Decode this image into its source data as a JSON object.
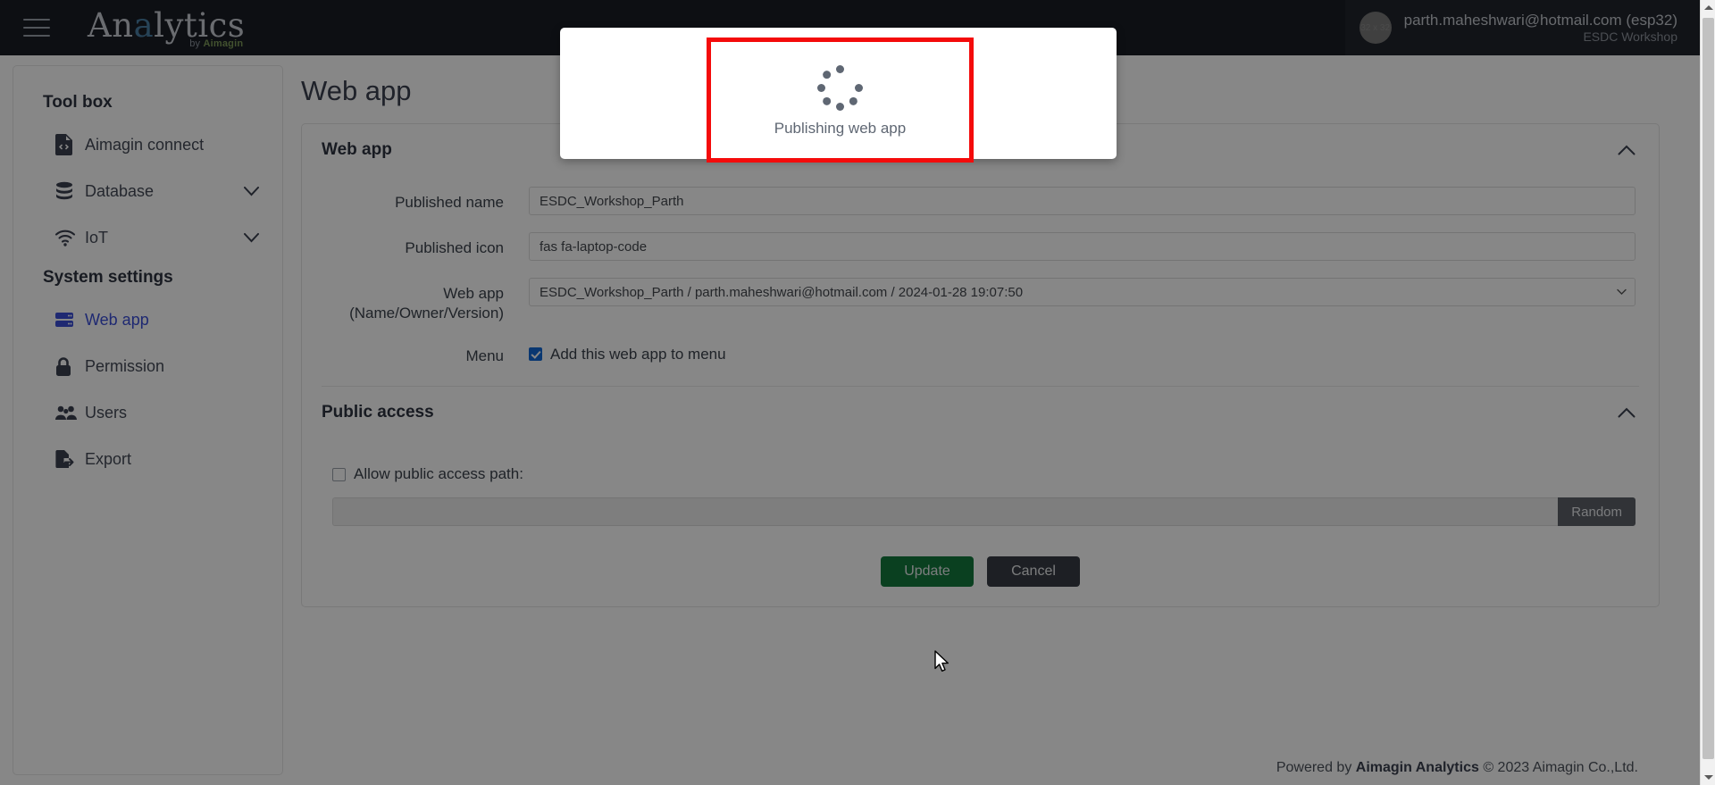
{
  "header": {
    "menu_icon": "hamburger-icon",
    "brand": {
      "text_before": "An",
      "highlight": "a",
      "text_after": "lytics",
      "sub_prefix": "by ",
      "sub_brand": "Aimagin"
    },
    "user": {
      "avatar_placeholder": "32 x 32",
      "email": "parth.maheshwari@hotmail.com (esp32)",
      "team": "ESDC Workshop"
    }
  },
  "sidebar": {
    "groups": [
      {
        "title": "Tool box",
        "items": [
          {
            "label": "Aimagin connect",
            "icon": "file-code-icon",
            "expandable": false,
            "active": false
          },
          {
            "label": "Database",
            "icon": "database-icon",
            "expandable": true,
            "active": false
          },
          {
            "label": "IoT",
            "icon": "wifi-icon",
            "expandable": true,
            "active": false
          }
        ]
      },
      {
        "title": "System settings",
        "items": [
          {
            "label": "Web app",
            "icon": "server-icon",
            "expandable": false,
            "active": true
          },
          {
            "label": "Permission",
            "icon": "lock-icon",
            "expandable": false,
            "active": false
          },
          {
            "label": "Users",
            "icon": "users-icon",
            "expandable": false,
            "active": false
          },
          {
            "label": "Export",
            "icon": "export-icon",
            "expandable": false,
            "active": false
          }
        ]
      }
    ]
  },
  "main": {
    "page_title": "Web app",
    "webapp_panel": {
      "title": "Web app",
      "collapse_icon": "chevron-up-icon",
      "fields": {
        "published_name_label": "Published name",
        "published_name_value": "ESDC_Workshop_Parth",
        "published_icon_label": "Published icon",
        "published_icon_value": "fas fa-laptop-code",
        "webapp_label_line1": "Web app",
        "webapp_label_line2": "(Name/Owner/Version)",
        "webapp_selected": "ESDC_Workshop_Parth / parth.maheshwari@hotmail.com / 2024-01-28 19:07:50",
        "menu_label": "Menu",
        "menu_checkbox_label": "Add this web app to menu",
        "menu_checked": true
      }
    },
    "public_access_panel": {
      "title": "Public access",
      "collapse_icon": "chevron-up-icon",
      "allow_label": "Allow public access path:",
      "allow_checked": false,
      "path_value": "",
      "random_button": "Random"
    },
    "actions": {
      "update_label": "Update",
      "cancel_label": "Cancel"
    }
  },
  "modal": {
    "spinner_label": "Publishing web app",
    "spinner_icon": "loading-spinner-icon",
    "highlight_color": "#f40b0b"
  },
  "footer": {
    "prefix": "Powered by ",
    "brand": "Aimagin Analytics",
    "suffix": " © 2023 Aimagin Co.,Ltd."
  },
  "colors": {
    "accent": "#3b4fd8",
    "primary_button": "#147a3d",
    "secondary_button": "#383c44",
    "topbar": "#191d25"
  }
}
